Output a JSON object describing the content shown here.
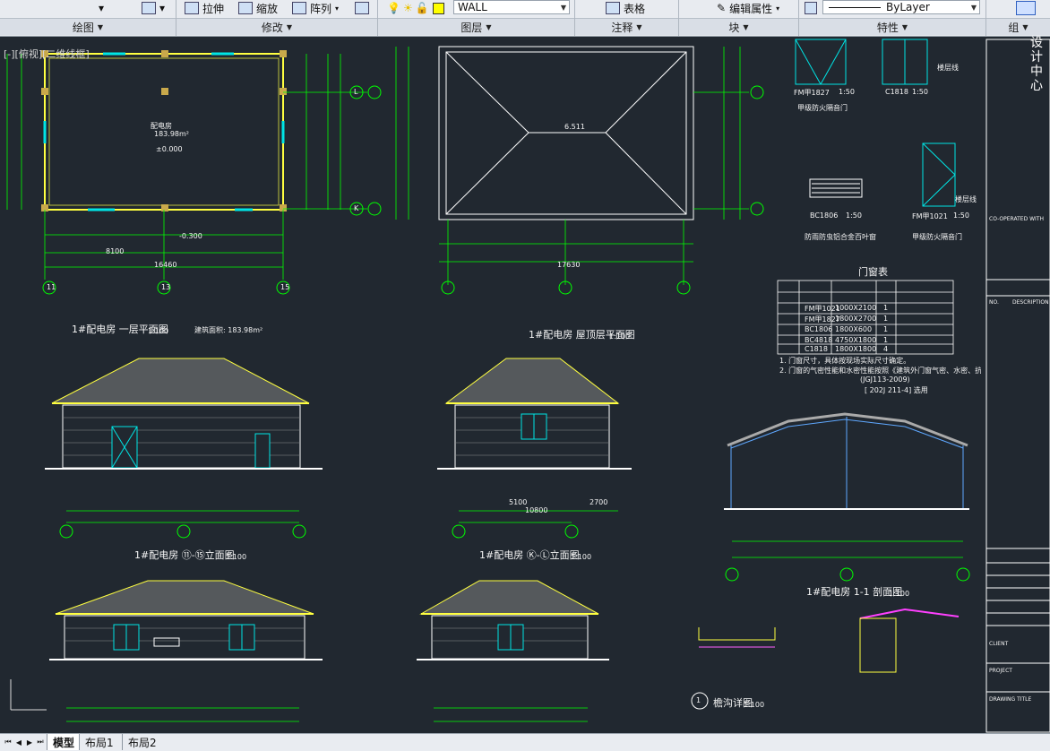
{
  "ribbon": {
    "tools": {
      "stretch": "拉伸",
      "scale": "缩放",
      "array": "阵列"
    },
    "layer_combo": "WALL",
    "table": "表格",
    "edit_attr": "编辑属性",
    "linetype": "ByLayer",
    "panels": [
      "绘图",
      "修改",
      "图层",
      "注释",
      "块",
      "特性",
      "组"
    ]
  },
  "viewport_label": "[-][俯视][二维线框]",
  "drawing": {
    "plan_titles": {
      "floor1": "1#配电房 一层平面图",
      "floor1_scale": "1:100",
      "floor1_area": "建筑面积: 183.98m²",
      "roof": "1#配电房 屋顶层平面图",
      "roof_scale": "1:100"
    },
    "plan_room": {
      "name": "配电房",
      "area": "183.98m²",
      "level": "±0.000",
      "outdoor": "-0.300"
    },
    "roof_level": "6.511",
    "doors": {
      "fm1827": "FM甲1827",
      "fm1827_scale": "1:50",
      "fm1827_desc": "甲级防火隔音门",
      "c1818": "C1818",
      "c1818_scale": "1:50",
      "bc1806": "BC1806",
      "bc1806_scale": "1:50",
      "bc1806_desc": "防雨防虫铝合金百叶窗",
      "fm1021": "FM甲1021",
      "fm1021_scale": "1:50",
      "fm1021_desc": "甲级防火隔音门",
      "floor_line": "楼层线"
    },
    "schedule_title": "门窗表",
    "schedule_rows": [
      [
        "FM甲1021",
        "1000X2100",
        "1"
      ],
      [
        "FM甲1827",
        "1800X2700",
        "1"
      ],
      [
        "BC1806",
        "1800X600",
        "1"
      ],
      [
        "BC4818",
        "4750X1800",
        "1"
      ],
      [
        "C1818",
        "1800X1800",
        "4"
      ]
    ],
    "notes": {
      "n1": "1. 门窗尺寸，具体按现场实际尺寸确定。",
      "n2": "2. 门窗的气密性能和水密性能按照《建筑外门窗气密、水密、抗风压性能分级及检测方法》",
      "n3": "(JGJ113-2009)",
      "n4": "[ 202J 211-4] 选用"
    },
    "elevations": {
      "e1": "1#配电房 ⑪-⑮立面图",
      "e1_scale": "1:100",
      "e2": "1#配电房 ⑮-⑪立面图",
      "e2_scale": "1:100",
      "e3": "1#配电房 Ⓚ-Ⓛ立面图",
      "e3_scale": "1:100",
      "e4": "1#配电房 Ⓛ-Ⓚ立面图",
      "e4_scale": "1:100",
      "section": "1#配电房 1-1 剖面图",
      "section_scale": "1:100",
      "detail": "檐沟详图",
      "detail_scale": "1:100",
      "detail_no": "1"
    },
    "axis_labels": [
      "11",
      "13",
      "15",
      "K",
      "L"
    ],
    "dims": {
      "total_16460": "16460",
      "d8100": "8100",
      "d17630": "17630",
      "d10800": "10800",
      "d5100": "5100",
      "d2700": "2700"
    }
  },
  "title_block": {
    "company": "设计中心",
    "co_operated": "CO-OPERATED WITH",
    "no": "NO.",
    "description": "DESCRIPTION",
    "client": "CLIENT",
    "project": "PROJECT",
    "drawing_title": "DRAWING TITLE"
  },
  "tabs": {
    "model": "模型",
    "layout1": "布局1",
    "layout2": "布局2"
  }
}
